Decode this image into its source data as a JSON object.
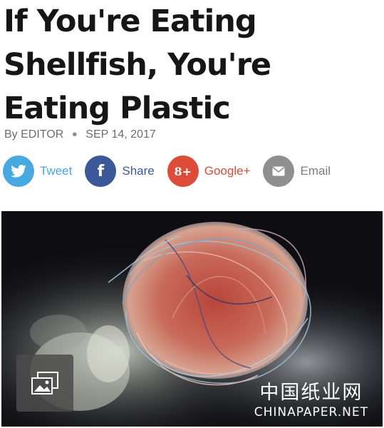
{
  "article": {
    "headline": "If You're Eating Shellfish, You're Eating Plastic",
    "byline": {
      "author": "By EDITOR",
      "separator": "•",
      "date": "SEP 14, 2017"
    }
  },
  "share": [
    {
      "label": "Tweet",
      "icon": "twitter-icon",
      "glyph": "🐦",
      "color": "#48a8e2",
      "text_color": "#48a8e2"
    },
    {
      "label": "Share",
      "icon": "facebook-icon",
      "glyph": "f",
      "color": "#3b5998",
      "text_color": "#3b5998"
    },
    {
      "label": "Google+",
      "icon": "google-plus-icon",
      "glyph": "8+",
      "color": "#dd4b39",
      "text_color": "#dd4b39"
    },
    {
      "label": "Email",
      "icon": "email-icon",
      "glyph": "✉",
      "color": "#8f8f8f",
      "text_color": "#7d7d7d"
    }
  ],
  "photo": {
    "gallery_icon": "image-gallery-icon",
    "watermark_cn": "中国纸业网",
    "watermark_en": "CHINAPAPER.NET"
  },
  "colors": {
    "headline": "#161616",
    "byline": "#6d6d6d",
    "photo_bg": "#0d0d12"
  }
}
